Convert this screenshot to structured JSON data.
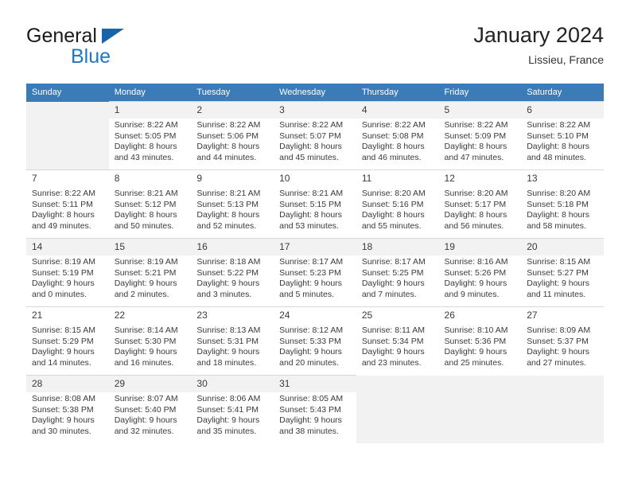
{
  "brand": {
    "name_top": "General",
    "name_bottom": "Blue",
    "accent_color": "#2077c4",
    "triangle_color": "#1565a8"
  },
  "header": {
    "title": "January 2024",
    "subtitle": "Lissieu, France"
  },
  "calendar": {
    "header_bg": "#3b7cb8",
    "weekday_headers": [
      "Sunday",
      "Monday",
      "Tuesday",
      "Wednesday",
      "Thursday",
      "Friday",
      "Saturday"
    ],
    "weeks": [
      [
        {
          "day": "",
          "lines": []
        },
        {
          "day": "1",
          "lines": [
            "Sunrise: 8:22 AM",
            "Sunset: 5:05 PM",
            "Daylight: 8 hours",
            "and 43 minutes."
          ]
        },
        {
          "day": "2",
          "lines": [
            "Sunrise: 8:22 AM",
            "Sunset: 5:06 PM",
            "Daylight: 8 hours",
            "and 44 minutes."
          ]
        },
        {
          "day": "3",
          "lines": [
            "Sunrise: 8:22 AM",
            "Sunset: 5:07 PM",
            "Daylight: 8 hours",
            "and 45 minutes."
          ]
        },
        {
          "day": "4",
          "lines": [
            "Sunrise: 8:22 AM",
            "Sunset: 5:08 PM",
            "Daylight: 8 hours",
            "and 46 minutes."
          ]
        },
        {
          "day": "5",
          "lines": [
            "Sunrise: 8:22 AM",
            "Sunset: 5:09 PM",
            "Daylight: 8 hours",
            "and 47 minutes."
          ]
        },
        {
          "day": "6",
          "lines": [
            "Sunrise: 8:22 AM",
            "Sunset: 5:10 PM",
            "Daylight: 8 hours",
            "and 48 minutes."
          ]
        }
      ],
      [
        {
          "day": "7",
          "lines": [
            "Sunrise: 8:22 AM",
            "Sunset: 5:11 PM",
            "Daylight: 8 hours",
            "and 49 minutes."
          ]
        },
        {
          "day": "8",
          "lines": [
            "Sunrise: 8:21 AM",
            "Sunset: 5:12 PM",
            "Daylight: 8 hours",
            "and 50 minutes."
          ]
        },
        {
          "day": "9",
          "lines": [
            "Sunrise: 8:21 AM",
            "Sunset: 5:13 PM",
            "Daylight: 8 hours",
            "and 52 minutes."
          ]
        },
        {
          "day": "10",
          "lines": [
            "Sunrise: 8:21 AM",
            "Sunset: 5:15 PM",
            "Daylight: 8 hours",
            "and 53 minutes."
          ]
        },
        {
          "day": "11",
          "lines": [
            "Sunrise: 8:20 AM",
            "Sunset: 5:16 PM",
            "Daylight: 8 hours",
            "and 55 minutes."
          ]
        },
        {
          "day": "12",
          "lines": [
            "Sunrise: 8:20 AM",
            "Sunset: 5:17 PM",
            "Daylight: 8 hours",
            "and 56 minutes."
          ]
        },
        {
          "day": "13",
          "lines": [
            "Sunrise: 8:20 AM",
            "Sunset: 5:18 PM",
            "Daylight: 8 hours",
            "and 58 minutes."
          ]
        }
      ],
      [
        {
          "day": "14",
          "lines": [
            "Sunrise: 8:19 AM",
            "Sunset: 5:19 PM",
            "Daylight: 9 hours",
            "and 0 minutes."
          ]
        },
        {
          "day": "15",
          "lines": [
            "Sunrise: 8:19 AM",
            "Sunset: 5:21 PM",
            "Daylight: 9 hours",
            "and 2 minutes."
          ]
        },
        {
          "day": "16",
          "lines": [
            "Sunrise: 8:18 AM",
            "Sunset: 5:22 PM",
            "Daylight: 9 hours",
            "and 3 minutes."
          ]
        },
        {
          "day": "17",
          "lines": [
            "Sunrise: 8:17 AM",
            "Sunset: 5:23 PM",
            "Daylight: 9 hours",
            "and 5 minutes."
          ]
        },
        {
          "day": "18",
          "lines": [
            "Sunrise: 8:17 AM",
            "Sunset: 5:25 PM",
            "Daylight: 9 hours",
            "and 7 minutes."
          ]
        },
        {
          "day": "19",
          "lines": [
            "Sunrise: 8:16 AM",
            "Sunset: 5:26 PM",
            "Daylight: 9 hours",
            "and 9 minutes."
          ]
        },
        {
          "day": "20",
          "lines": [
            "Sunrise: 8:15 AM",
            "Sunset: 5:27 PM",
            "Daylight: 9 hours",
            "and 11 minutes."
          ]
        }
      ],
      [
        {
          "day": "21",
          "lines": [
            "Sunrise: 8:15 AM",
            "Sunset: 5:29 PM",
            "Daylight: 9 hours",
            "and 14 minutes."
          ]
        },
        {
          "day": "22",
          "lines": [
            "Sunrise: 8:14 AM",
            "Sunset: 5:30 PM",
            "Daylight: 9 hours",
            "and 16 minutes."
          ]
        },
        {
          "day": "23",
          "lines": [
            "Sunrise: 8:13 AM",
            "Sunset: 5:31 PM",
            "Daylight: 9 hours",
            "and 18 minutes."
          ]
        },
        {
          "day": "24",
          "lines": [
            "Sunrise: 8:12 AM",
            "Sunset: 5:33 PM",
            "Daylight: 9 hours",
            "and 20 minutes."
          ]
        },
        {
          "day": "25",
          "lines": [
            "Sunrise: 8:11 AM",
            "Sunset: 5:34 PM",
            "Daylight: 9 hours",
            "and 23 minutes."
          ]
        },
        {
          "day": "26",
          "lines": [
            "Sunrise: 8:10 AM",
            "Sunset: 5:36 PM",
            "Daylight: 9 hours",
            "and 25 minutes."
          ]
        },
        {
          "day": "27",
          "lines": [
            "Sunrise: 8:09 AM",
            "Sunset: 5:37 PM",
            "Daylight: 9 hours",
            "and 27 minutes."
          ]
        }
      ],
      [
        {
          "day": "28",
          "lines": [
            "Sunrise: 8:08 AM",
            "Sunset: 5:38 PM",
            "Daylight: 9 hours",
            "and 30 minutes."
          ]
        },
        {
          "day": "29",
          "lines": [
            "Sunrise: 8:07 AM",
            "Sunset: 5:40 PM",
            "Daylight: 9 hours",
            "and 32 minutes."
          ]
        },
        {
          "day": "30",
          "lines": [
            "Sunrise: 8:06 AM",
            "Sunset: 5:41 PM",
            "Daylight: 9 hours",
            "and 35 minutes."
          ]
        },
        {
          "day": "31",
          "lines": [
            "Sunrise: 8:05 AM",
            "Sunset: 5:43 PM",
            "Daylight: 9 hours",
            "and 38 minutes."
          ]
        },
        {
          "day": "",
          "lines": []
        },
        {
          "day": "",
          "lines": []
        },
        {
          "day": "",
          "lines": []
        }
      ]
    ]
  }
}
